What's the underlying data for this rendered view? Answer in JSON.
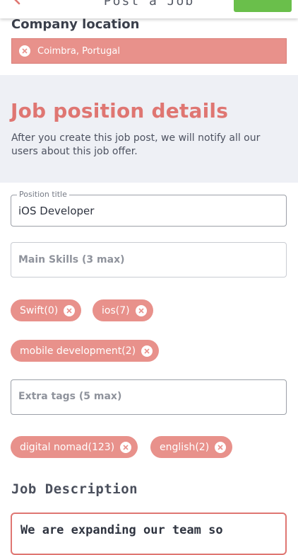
{
  "header": {
    "title": "Post a Job",
    "post_button_label": ""
  },
  "company_location": {
    "label": "Company location",
    "value": "Coimbra, Portugal"
  },
  "details": {
    "title": "Job position details",
    "description": "After you create this job post, we will notify all our users about this job offer."
  },
  "position_title": {
    "legend": "Position title",
    "value": "iOS Developer"
  },
  "main_skills": {
    "placeholder": "Main Skills (3 max)",
    "tags": [
      "Swift(0)",
      "ios(7)",
      "mobile development(2)"
    ]
  },
  "extra_tags": {
    "placeholder": "Extra tags (5 max)",
    "tags": [
      "digital nomad(123)",
      "english(2)"
    ]
  },
  "job_description": {
    "label": "Job Description",
    "text": "We are expanding our team so"
  },
  "colors": {
    "accent": "#df7672",
    "chip": "#e8918b",
    "post_button": "#6abf4b",
    "section_bg": "#eef0f5"
  }
}
